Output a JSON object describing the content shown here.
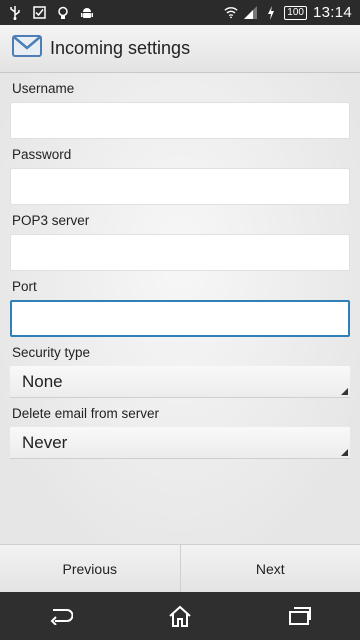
{
  "status_bar": {
    "battery": "100",
    "time": "13:14"
  },
  "header": {
    "title": "Incoming settings",
    "icon": "email-icon"
  },
  "form": {
    "username": {
      "label": "Username",
      "value": ""
    },
    "password": {
      "label": "Password",
      "value": ""
    },
    "pop3_server": {
      "label": "POP3 server",
      "value": ""
    },
    "port": {
      "label": "Port",
      "value": ""
    },
    "security_type": {
      "label": "Security type",
      "value": "None"
    },
    "delete_email": {
      "label": "Delete email from server",
      "value": "Never"
    }
  },
  "buttons": {
    "previous": "Previous",
    "next": "Next"
  },
  "colors": {
    "focus": "#2d80b8",
    "status_bar": "#2b2b2b",
    "nav_bar": "#2f2f2f"
  }
}
